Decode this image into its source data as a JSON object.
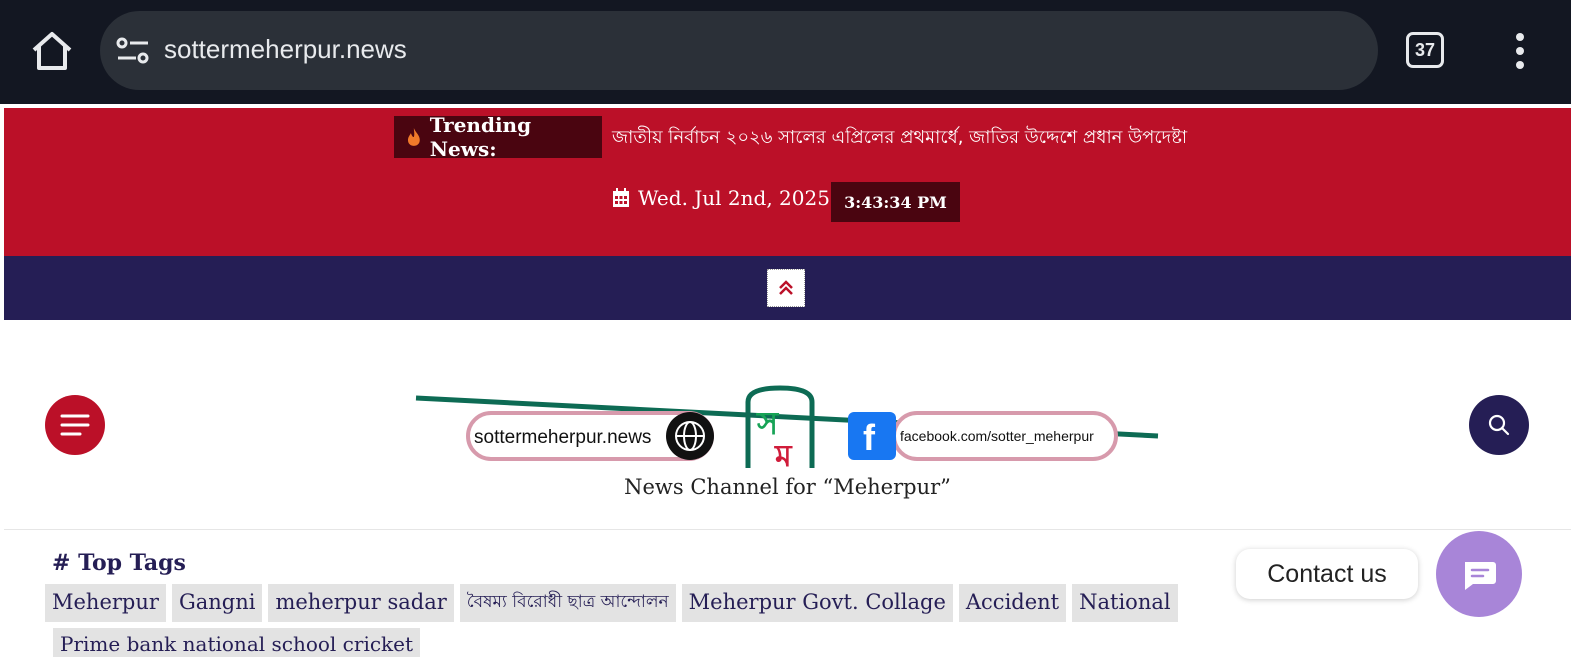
{
  "browser": {
    "url": "sottermeherpur.news",
    "tab_count": "37"
  },
  "topbar": {
    "trending_label": "Trending News:",
    "trending_text": "জাতীয় নির্বাচন ২০২৬ সালের এপ্রিলের প্রথমার্ধে, জাতির উদ্দেশে প্রধান উপদেষ্টা",
    "date": "Wed. Jul 2nd, 2025",
    "time": "3:43:34 PM",
    "accent_color": "#bb1028",
    "dark_color": "#4a0510"
  },
  "navbar": {
    "color": "#251e55"
  },
  "header": {
    "logo_site": "sottermeherpur.news",
    "logo_facebook": "facebook.com/sotter_meherpur",
    "tagline": "News Channel for “Meherpur”"
  },
  "tags": {
    "title": "Top Tags",
    "items": [
      "Meherpur",
      "Gangni",
      "meherpur sadar",
      "বৈষম্য বিরোধী ছাত্র আন্দোলন",
      "Meherpur Govt. Collage",
      "Accident",
      "National",
      "Prime bank national school cricket"
    ]
  },
  "contact": {
    "label": "Contact us"
  }
}
